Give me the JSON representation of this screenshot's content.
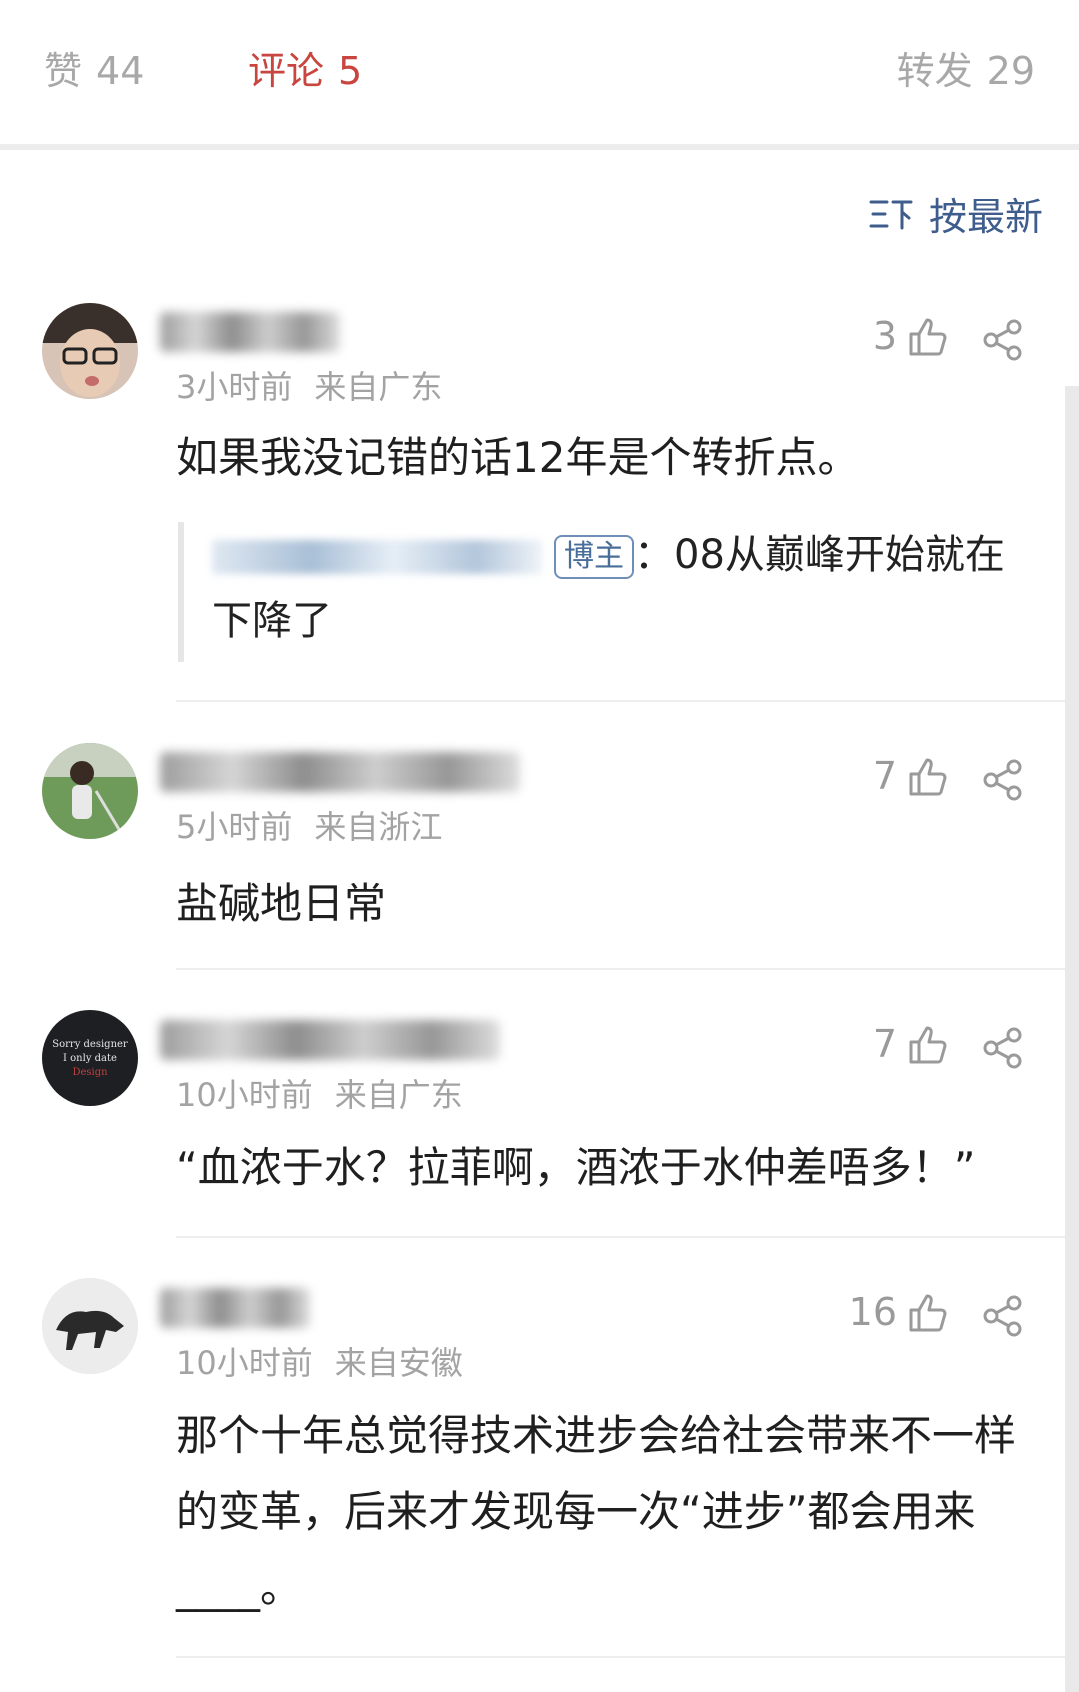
{
  "tabs": [
    {
      "label": "赞",
      "count": "44"
    },
    {
      "label": "评论",
      "count": "5"
    },
    {
      "label": "转发",
      "count": "29"
    }
  ],
  "sort": {
    "label": "按最新"
  },
  "comments": [
    {
      "time": "3小时前",
      "location": "来自广东",
      "likes": "3",
      "text": "如果我没记错的话12年是个转折点。",
      "reply": {
        "badge": "博主",
        "text": "：08从巅峰开始就在下降了"
      }
    },
    {
      "time": "5小时前",
      "location": "来自浙江",
      "likes": "7",
      "text": "盐碱地日常"
    },
    {
      "time": "10小时前",
      "location": "来自广东",
      "likes": "7",
      "text": "“血浓于水？拉菲啊，酒浓于水仲差唔多！”",
      "avatar_text": [
        "Sorry designer",
        "I only date",
        "Design"
      ]
    },
    {
      "time": "10小时前",
      "location": "来自安徽",
      "likes": "16",
      "text": "那个十年总觉得技术进步会给社会带来不一样的变革，后来才发现每一次“进步”都会用来____。"
    }
  ],
  "colors": {
    "accent": "#c9453f",
    "link": "#3f5d8c",
    "muted": "#a3a3a3"
  }
}
